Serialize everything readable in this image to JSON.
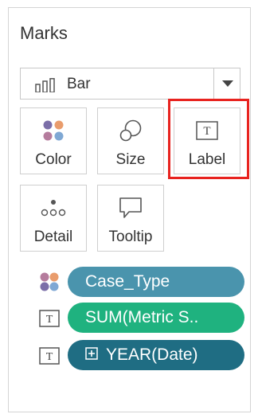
{
  "marks": {
    "title": "Marks",
    "mark_type": {
      "label": "Bar",
      "icon": "bar-chart-icon"
    },
    "buttons": [
      {
        "label": "Color",
        "icon": "color-dots-icon"
      },
      {
        "label": "Size",
        "icon": "size-circles-icon"
      },
      {
        "label": "Label",
        "icon": "text-label-icon",
        "highlighted": true
      },
      {
        "label": "Detail",
        "icon": "detail-dots-icon"
      },
      {
        "label": "Tooltip",
        "icon": "tooltip-bubble-icon"
      }
    ],
    "fields": [
      {
        "label": "Case_Type",
        "encoding": "color",
        "color": "#4a94ad"
      },
      {
        "label": "SUM(Metric S..",
        "encoding": "label",
        "color": "#1fb27f"
      },
      {
        "label": "YEAR(Date)",
        "encoding": "label",
        "color": "#1f6d83",
        "expand_icon": true
      }
    ]
  },
  "colors": {
    "highlight": "#e8231f",
    "dot_pink": "#b57c9d",
    "dot_orange": "#e99c6c",
    "dot_purple": "#7b6ea8",
    "dot_blue": "#7fa8d4"
  }
}
